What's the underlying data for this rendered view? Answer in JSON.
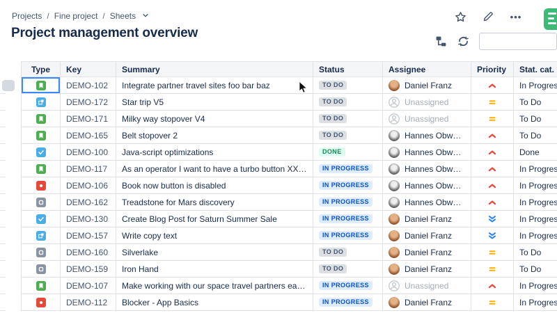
{
  "breadcrumb": {
    "items": [
      "Projects",
      "Fine project",
      "Sheets"
    ]
  },
  "page": {
    "title": "Project management overview"
  },
  "top_actions": {
    "star": "star-icon",
    "edit": "pencil-icon",
    "more": "ellipsis-icon"
  },
  "toolbar": {
    "search_value": "",
    "search_placeholder": ""
  },
  "colors": {
    "focus_border": "#388BFF",
    "status_todo_bg": "#DCDFE4",
    "status_todo_text": "#44546F",
    "status_inprogress_bg": "#DEEBFF",
    "status_inprogress_text": "#0052CC",
    "status_done_bg": "#DCFFF1",
    "status_done_text": "#1F845A",
    "priority_high": "#E5493A",
    "priority_medium": "#FFAB00",
    "priority_lowest": "#2684FF",
    "type_story": "#4CAE50",
    "type_task": "#4BADE8",
    "type_bug": "#E5493A",
    "type_issue_gray": "#8993A4"
  },
  "table": {
    "columns": [
      "Type",
      "Key",
      "Summary",
      "Status",
      "Assignee",
      "Priority",
      "Stat. cat."
    ],
    "rows": [
      {
        "type": "story",
        "key": "DEMO-102",
        "summary": "Integrate partner travel sites foo bar baz",
        "status": "TO DO",
        "assignee": "Daniel Franz",
        "avatar": "daniel",
        "priority": "high",
        "stat_cat": "In Progress",
        "selected": true
      },
      {
        "type": "subtask",
        "key": "DEMO-172",
        "summary": "Star trip V5",
        "status": "TO DO",
        "assignee": "Unassigned",
        "avatar": "unassigned",
        "priority": "medium",
        "stat_cat": "To Do",
        "selected": false
      },
      {
        "type": "story",
        "key": "DEMO-171",
        "summary": "Milky way stopover V4",
        "status": "TO DO",
        "assignee": "Unassigned",
        "avatar": "unassigned",
        "priority": "medium",
        "stat_cat": "To Do",
        "selected": false
      },
      {
        "type": "story",
        "key": "DEMO-165",
        "summary": "Belt stopover 2",
        "status": "TO DO",
        "assignee": "Hannes Obweger",
        "avatar": "hannes",
        "priority": "high",
        "stat_cat": "To Do",
        "selected": false
      },
      {
        "type": "task",
        "key": "DEMO-100",
        "summary": "Java-script optimizations",
        "status": "DONE",
        "assignee": "Hannes Obweger",
        "avatar": "hannes",
        "priority": "high",
        "stat_cat": "Done",
        "selected": false
      },
      {
        "type": "story",
        "key": "DEMO-117",
        "summary": "As an operator I want to have a turbo button XXX...",
        "status": "IN PROGRESS",
        "assignee": "Hannes Obweger",
        "avatar": "hannes",
        "priority": "high",
        "stat_cat": "In Progress",
        "selected": false
      },
      {
        "type": "bug",
        "key": "DEMO-106",
        "summary": "Book now button is disabled",
        "status": "IN PROGRESS",
        "assignee": "Hannes Obweger",
        "avatar": "hannes",
        "priority": "high",
        "stat_cat": "In Progress",
        "selected": false
      },
      {
        "type": "issue",
        "key": "DEMO-162",
        "summary": "Treadstone for Mars discovery",
        "status": "IN PROGRESS",
        "assignee": "Hannes Obweger",
        "avatar": "hannes",
        "priority": "high",
        "stat_cat": "In Progress",
        "selected": false
      },
      {
        "type": "task",
        "key": "DEMO-130",
        "summary": "Create Blog Post for Saturn Summer Sale",
        "status": "IN PROGRESS",
        "assignee": "Daniel Franz",
        "avatar": "daniel",
        "priority": "lowest",
        "stat_cat": "In Progress",
        "selected": false
      },
      {
        "type": "subtask",
        "key": "DEMO-157",
        "summary": "Write copy text",
        "status": "IN PROGRESS",
        "assignee": "Daniel Franz",
        "avatar": "daniel",
        "priority": "lowest",
        "stat_cat": "In Progress",
        "selected": false
      },
      {
        "type": "issue",
        "key": "DEMO-160",
        "summary": "Silverlake",
        "status": "TO DO",
        "assignee": "Daniel Franz",
        "avatar": "daniel",
        "priority": "medium",
        "stat_cat": "To Do",
        "selected": false
      },
      {
        "type": "issue",
        "key": "DEMO-159",
        "summary": "Iron Hand",
        "status": "TO DO",
        "assignee": "Daniel Franz",
        "avatar": "daniel",
        "priority": "medium",
        "stat_cat": "To Do",
        "selected": false
      },
      {
        "type": "story",
        "key": "DEMO-107",
        "summary": "Make working with our space travel partners easier",
        "status": "IN PROGRESS",
        "assignee": "Unassigned",
        "avatar": "unassigned",
        "priority": "high",
        "stat_cat": "In Progress",
        "selected": false
      },
      {
        "type": "bug",
        "key": "DEMO-112",
        "summary": "Blocker - App Basics",
        "status": "IN PROGRESS",
        "assignee": "Daniel Franz",
        "avatar": "daniel",
        "priority": "medium",
        "stat_cat": "In Progress",
        "selected": false
      }
    ]
  }
}
